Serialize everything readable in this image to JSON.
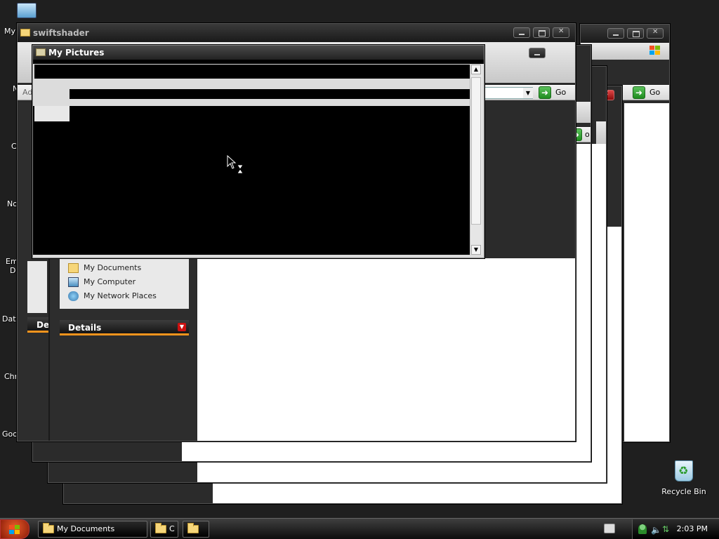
{
  "desktop": {
    "icons": [
      "My",
      "N",
      "C",
      "No",
      "Em",
      "D",
      "Data",
      "Chr",
      "Goo"
    ],
    "recycle_bin_label": "Recycle Bin"
  },
  "windows": {
    "swiftshader": {
      "title": "swiftshader"
    },
    "my_pictures": {
      "title": "My Pictures"
    }
  },
  "address_bar": {
    "label": "Address",
    "go_label": "Go",
    "go_label_back": "Go",
    "go_partial": "o"
  },
  "task_pane": {
    "other_places": [
      "My Documents",
      "My Computer",
      "My Network Places"
    ],
    "details_header": "Details",
    "partial_header": "De"
  },
  "taskbar": {
    "buttons": [
      {
        "label": "My Documents"
      },
      {
        "label": "C"
      },
      {
        "label": ""
      }
    ],
    "clock": "2:03 PM"
  },
  "colors": {
    "accent": "#f7941d",
    "desktop": "#1f1f1f"
  }
}
